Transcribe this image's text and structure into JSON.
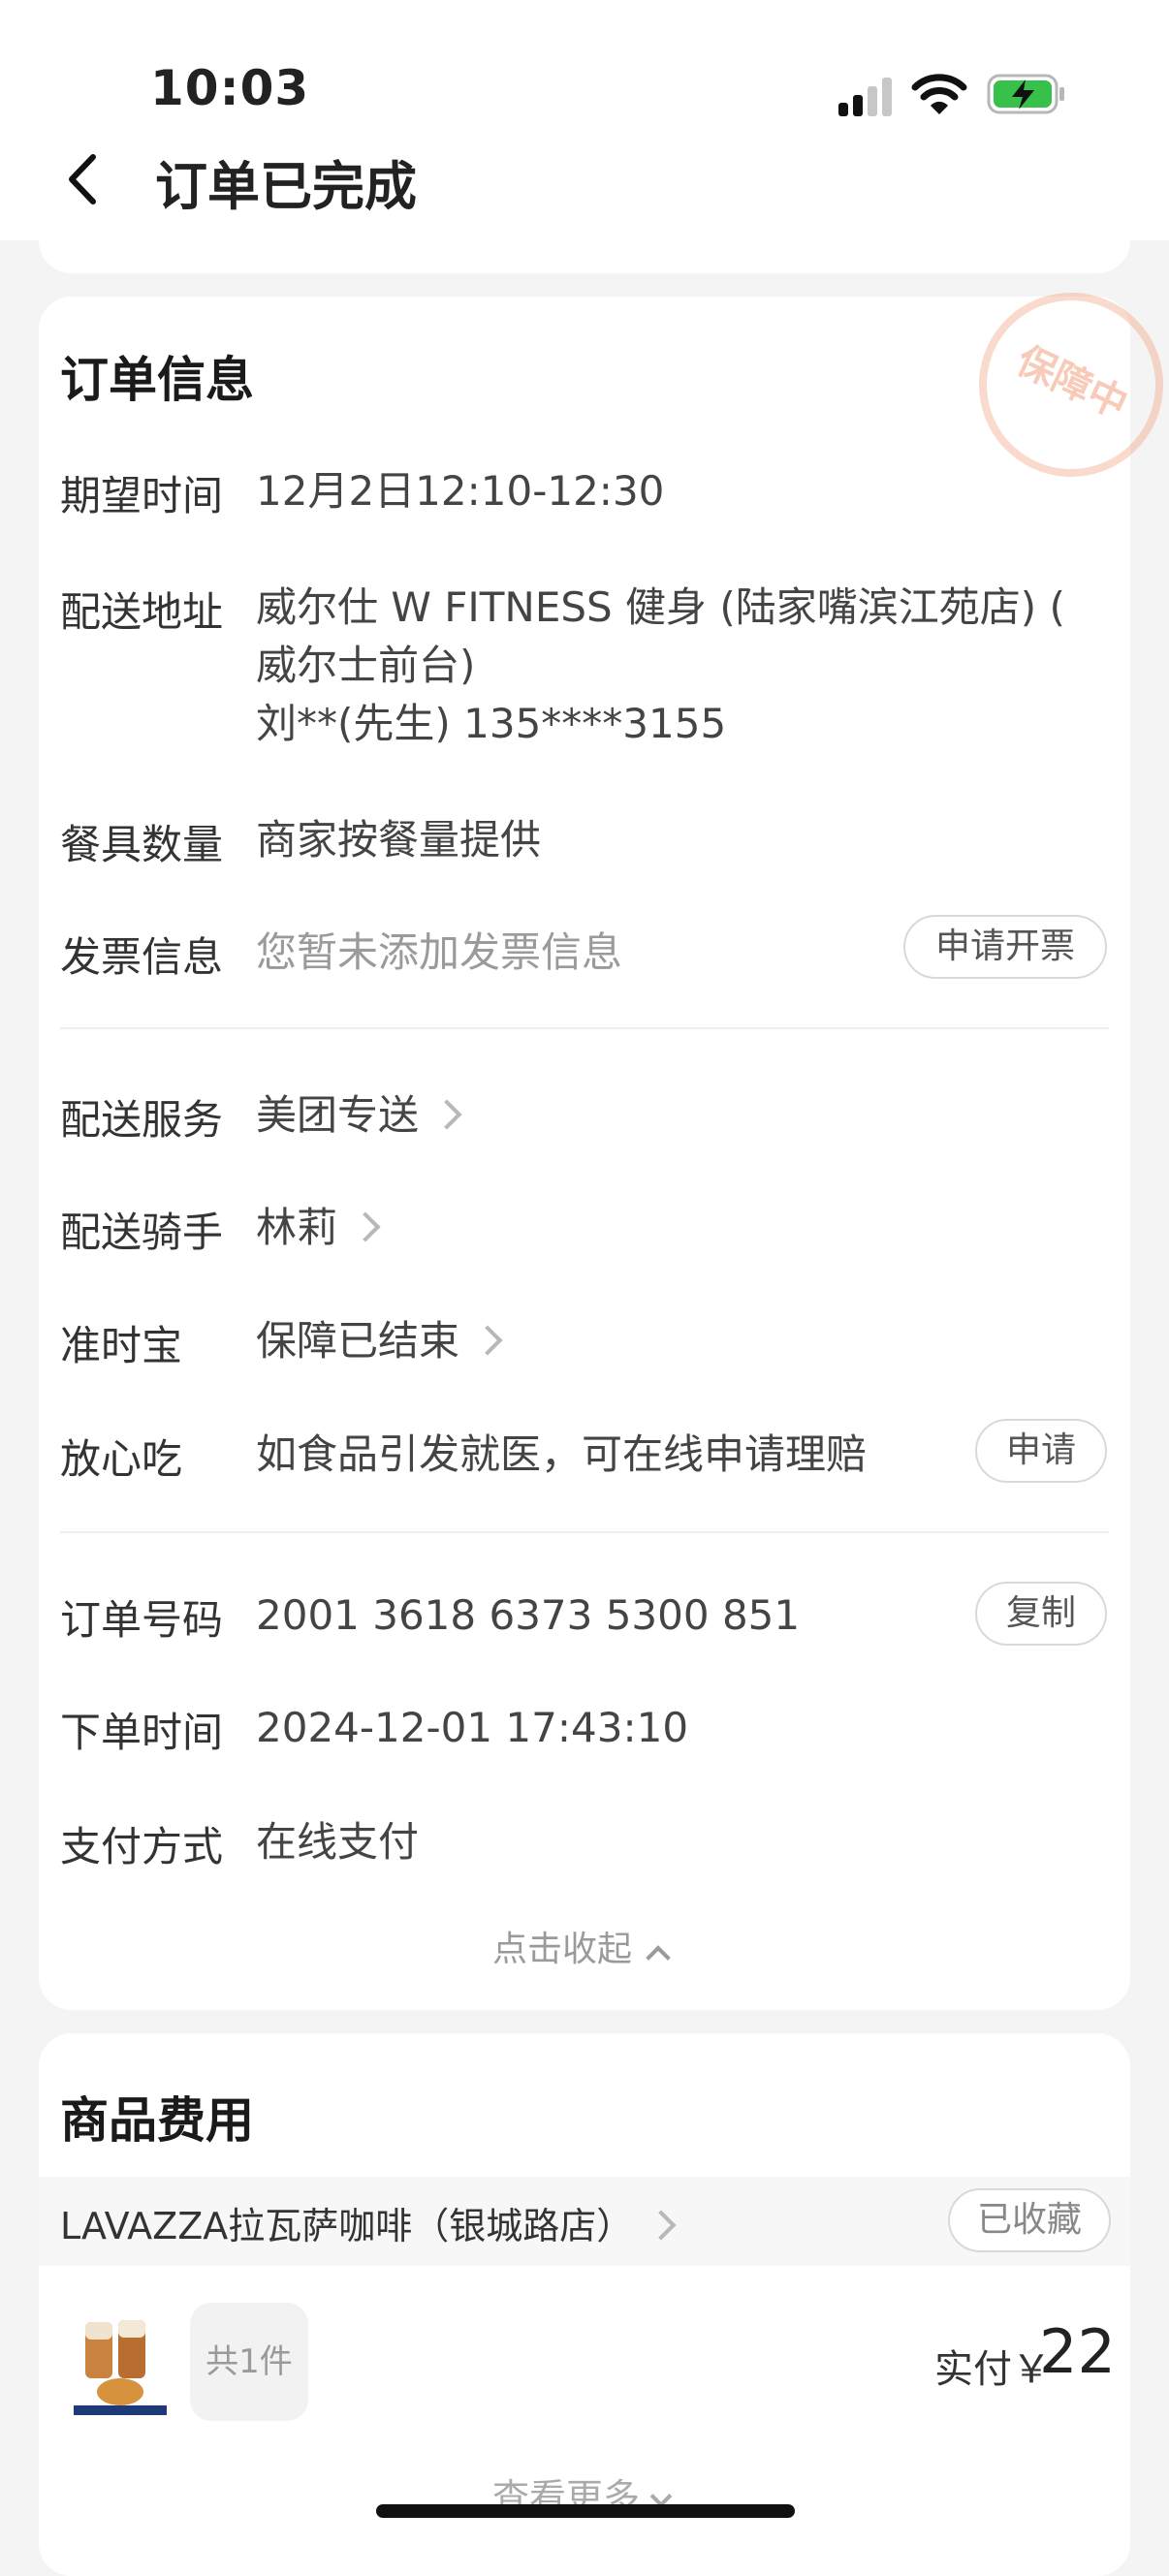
{
  "status": {
    "time": "10:03"
  },
  "header": {
    "title": "订单已完成"
  },
  "order_info": {
    "title": "订单信息",
    "stamp": "保障中",
    "expected_time": {
      "label": "期望时间",
      "value": "12月2日12:10-12:30"
    },
    "address": {
      "label": "配送地址",
      "line1": "威尔仕 W FITNESS 健身 (陆家嘴滨江苑店) (",
      "line2": "威尔士前台)",
      "line3": "刘**(先生) 135****3155"
    },
    "tableware": {
      "label": "餐具数量",
      "value": "商家按餐量提供"
    },
    "invoice": {
      "label": "发票信息",
      "value": "您暂未添加发票信息",
      "button": "申请开票"
    },
    "delivery_service": {
      "label": "配送服务",
      "value": "美团专送"
    },
    "rider": {
      "label": "配送骑手",
      "value": "林莉"
    },
    "on_time": {
      "label": "准时宝",
      "value": "保障已结束"
    },
    "food_safety": {
      "label": "放心吃",
      "value": "如食品引发就医，可在线申请理赔",
      "button": "申请"
    },
    "order_no": {
      "label": "订单号码",
      "value": "2001 3618 6373 5300 851",
      "button": "复制"
    },
    "order_time": {
      "label": "下单时间",
      "value": "2024-12-01 17:43:10"
    },
    "payment": {
      "label": "支付方式",
      "value": "在线支付"
    },
    "collapse": "点击收起"
  },
  "fees": {
    "title": "商品费用",
    "shop_name": "LAVAZZA拉瓦萨咖啡（银城路店）",
    "favorited": "已收藏",
    "count": "共1件",
    "paid_label": "实付￥",
    "paid_amount": "22",
    "more": "查看更多"
  }
}
